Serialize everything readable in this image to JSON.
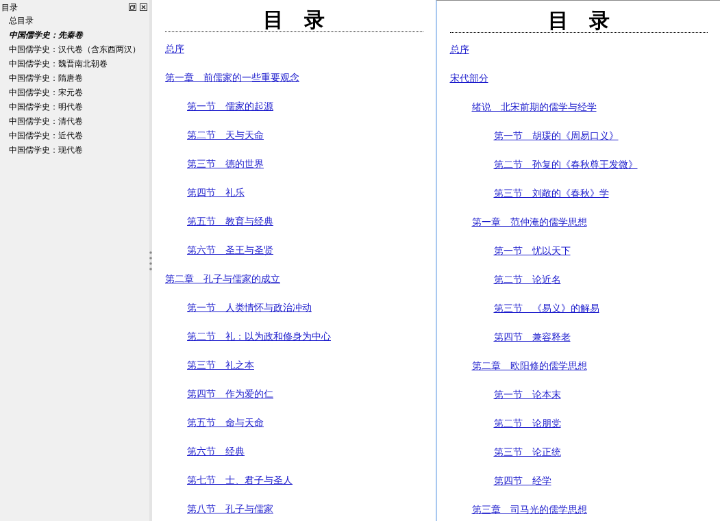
{
  "sidebar": {
    "title": "目录",
    "items": [
      {
        "label": "总目录",
        "selected": false
      },
      {
        "label": "中国儒学史：先秦卷",
        "selected": true
      },
      {
        "label": "中国儒学史：汉代卷（含东西两汉）",
        "selected": false
      },
      {
        "label": "中国儒学史：魏晋南北朝卷",
        "selected": false
      },
      {
        "label": "中国儒学史：隋唐卷",
        "selected": false
      },
      {
        "label": "中国儒学史：宋元卷",
        "selected": false
      },
      {
        "label": "中国儒学史：明代卷",
        "selected": false
      },
      {
        "label": "中国儒学史：清代卷",
        "selected": false
      },
      {
        "label": "中国儒学史：近代卷",
        "selected": false
      },
      {
        "label": "中国儒学史：现代卷",
        "selected": false
      }
    ]
  },
  "pages": [
    {
      "heading": "目　录",
      "entries": [
        {
          "label": "总序"
        },
        {
          "label": "第一章　前儒家的一些重要观念",
          "children": [
            {
              "label": "第一节　儒家的起源"
            },
            {
              "label": "第二节　天与天命"
            },
            {
              "label": "第三节　德的世界"
            },
            {
              "label": "第四节　礼乐"
            },
            {
              "label": "第五节　教育与经典"
            },
            {
              "label": "第六节　圣王与圣贤"
            }
          ]
        },
        {
          "label": "第二章　孔子与儒家的成立",
          "children": [
            {
              "label": "第一节　人类情怀与政治冲动"
            },
            {
              "label": "第二节　礼：以为政和修身为中心"
            },
            {
              "label": "第三节　礼之本"
            },
            {
              "label": "第四节　作为爱的仁"
            },
            {
              "label": "第五节　命与天命"
            },
            {
              "label": "第六节　经典"
            },
            {
              "label": "第七节　士、君子与圣人"
            },
            {
              "label": "第八节　孔子与儒家"
            }
          ]
        }
      ]
    },
    {
      "heading": "目　录",
      "entries": [
        {
          "label": "总序"
        },
        {
          "label": "宋代部分",
          "children": [
            {
              "label": "绪说　北宋前期的儒学与经学",
              "children": [
                {
                  "label": "第一节　胡瑗的《周易口义》"
                },
                {
                  "label": "第二节　孙复的《春秋尊王发微》"
                },
                {
                  "label": "第三节　刘敞的《春秋》学"
                }
              ]
            },
            {
              "label": "第一章　范仲淹的儒学思想",
              "children": [
                {
                  "label": "第一节　忧以天下"
                },
                {
                  "label": "第二节　论近名"
                },
                {
                  "label": "第三节　《易义》的解易"
                },
                {
                  "label": "第四节　兼容释老"
                }
              ]
            },
            {
              "label": "第二章　欧阳修的儒学思想",
              "children": [
                {
                  "label": "第一节　论本末"
                },
                {
                  "label": "第二节　论朋党"
                },
                {
                  "label": "第三节　论正统"
                },
                {
                  "label": "第四节　经学"
                }
              ]
            },
            {
              "label": "第三章　司马光的儒学思想"
            }
          ]
        }
      ]
    }
  ]
}
